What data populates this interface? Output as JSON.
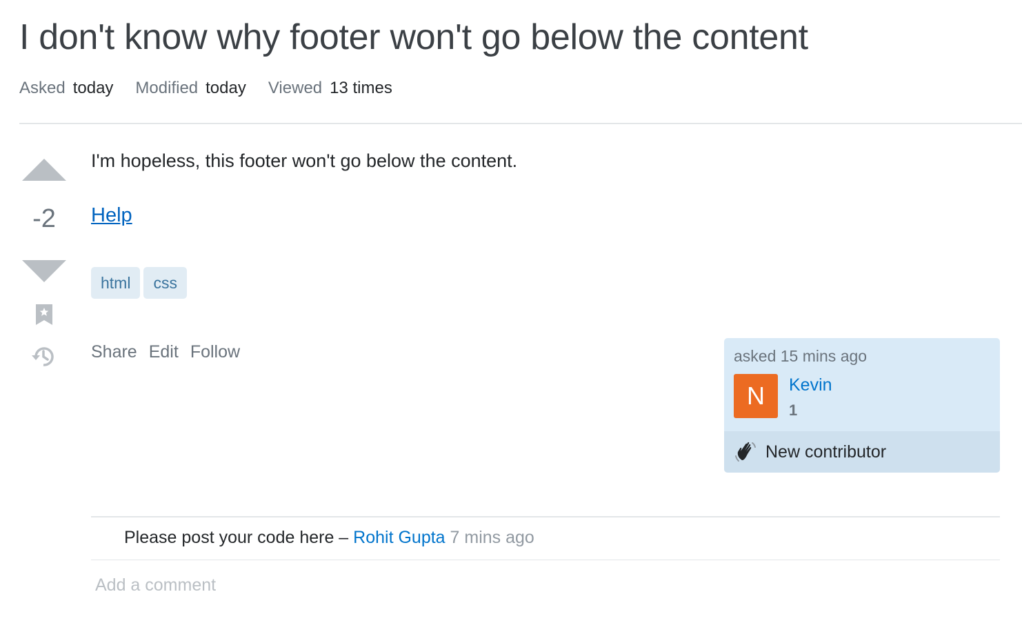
{
  "question": {
    "title": "I don't know why footer won't go below the content",
    "meta": {
      "asked_label": "Asked",
      "asked_value": "today",
      "modified_label": "Modified",
      "modified_value": "today",
      "viewed_label": "Viewed",
      "viewed_value": "13 times"
    },
    "vote_count": "-2",
    "body_text": "I'm hopeless, this footer won't go below the content.",
    "link_text": "Help",
    "tags": [
      "html",
      "css"
    ],
    "actions": {
      "share": "Share",
      "edit": "Edit",
      "follow": "Follow"
    }
  },
  "user_card": {
    "asked_time": "asked 15 mins ago",
    "avatar_letter": "N",
    "avatar_color": "#ec6b22",
    "name": "Kevin",
    "reputation": "1",
    "badge_icon": "wave-icon",
    "badge_label": "New contributor"
  },
  "comments": [
    {
      "text": "Please post your code here – ",
      "author": "Rohit Gupta",
      "time": "7 mins ago"
    }
  ],
  "add_comment_label": "Add a comment",
  "colors": {
    "link": "#0074cc",
    "tag_bg": "#e1ecf4",
    "tag_text": "#39739d",
    "card_bg": "#d9eaf7"
  }
}
